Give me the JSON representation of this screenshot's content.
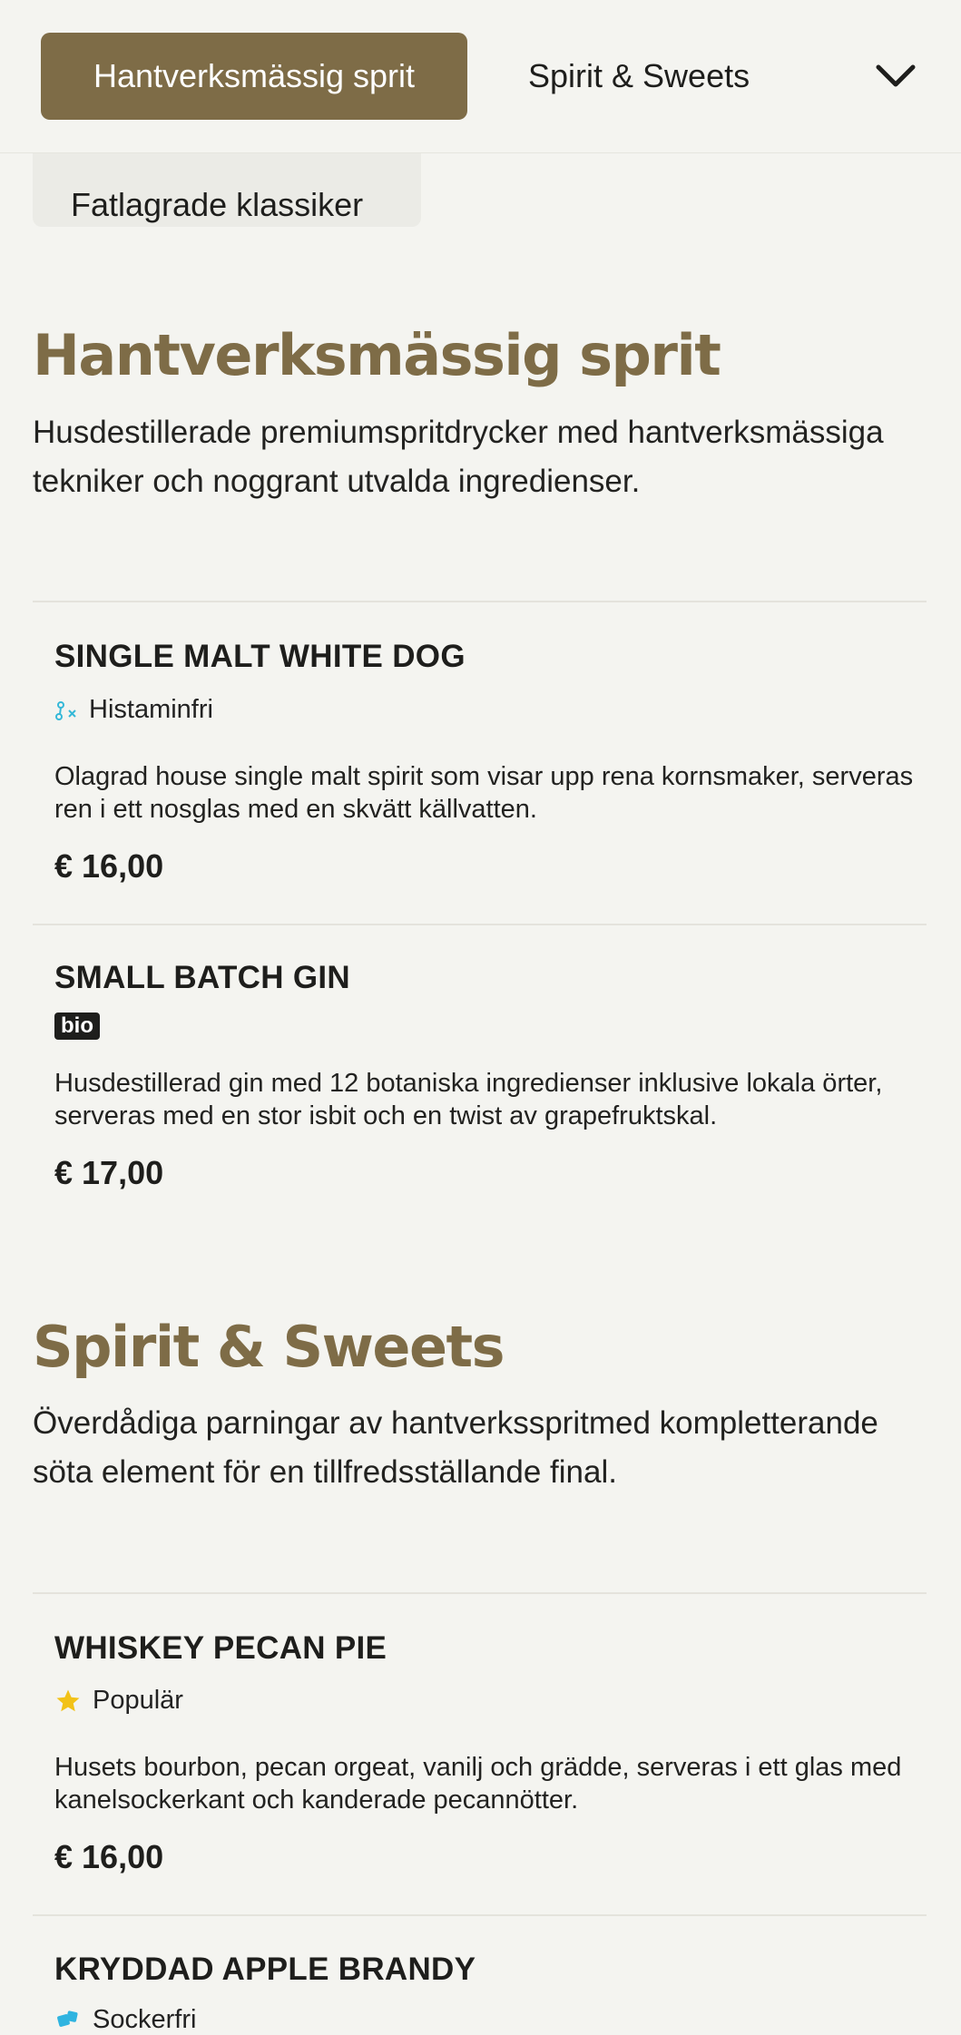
{
  "nav": {
    "active_tab": "Hantverksmässig sprit",
    "tab2": "Spirit & Sweets",
    "tab3": "Fatlagrade klassiker"
  },
  "sections": [
    {
      "title": "Hantverksmässig sprit",
      "description": "Husdestillerade premiumspritdrycker med hantverksmässiga tekniker och noggrant utvalda ingredienser.",
      "items": [
        {
          "name": "SINGLE MALT WHITE DOG",
          "tag": "Histaminfri",
          "description": "Olagrad house single malt spirit som visar upp rena kornsmaker, serveras ren i ett nosglas med en skvätt källvatten.",
          "price": "€ 16,00"
        },
        {
          "name": "SMALL BATCH GIN",
          "badge": "bio",
          "description": "Husdestillerad gin med 12 botaniska ingredienser inklusive lokala örter, serveras med en stor isbit och en twist av grapefruktskal.",
          "price": "€ 17,00"
        }
      ]
    },
    {
      "title": "Spirit & Sweets",
      "description": "Överdådiga parningar av hantverksspritmed kompletterande söta element för en tillfredsställande final.",
      "items": [
        {
          "name": "WHISKEY PECAN PIE",
          "tag": "Populär",
          "description": "Husets bourbon, pecan orgeat, vanilj och grädde, serveras i ett glas med kanelsockerkant och kanderade pecannötter.",
          "price": "€ 16,00"
        },
        {
          "name": "KRYDDAD APPLE BRANDY",
          "tag": "Sockerfri"
        }
      ]
    }
  ],
  "colors": {
    "accent": "#7e6c47",
    "background": "#f4f4f0",
    "histamine_icon": "#35b8d8",
    "star": "#f2c218",
    "sugarfree_icon": "#2fb4e0"
  }
}
